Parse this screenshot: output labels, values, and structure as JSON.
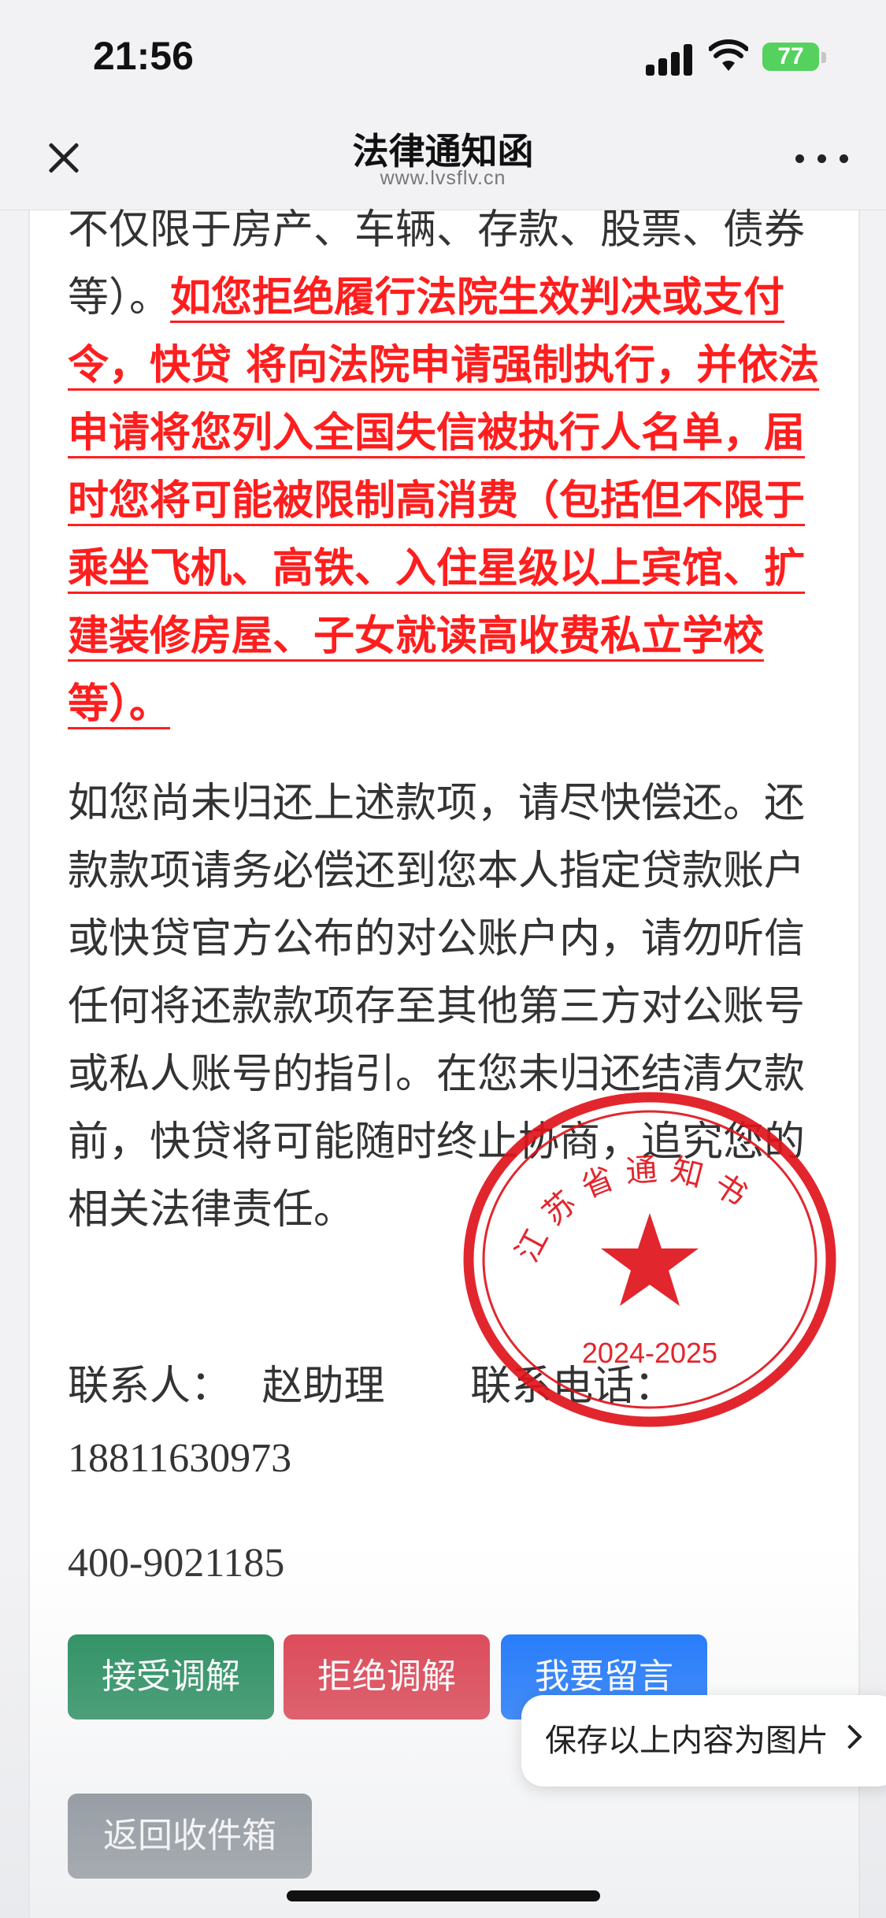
{
  "status_bar": {
    "time": "21:56",
    "battery": "77"
  },
  "nav": {
    "title": "法律通知函",
    "url": "www.lvsflv.cn"
  },
  "letter": {
    "p1_normal": "不仅限于房产、车辆、存款、股票、债券等）。",
    "p1_warning": "如您拒绝履行法院生效判决或支付令，快贷 将向法院申请强制执行，并依法申请将您列入全国失信被执行人名单，届时您将可能被限制高消费（包括但不限于乘坐飞机、高铁、入住星级以上宾馆、扩建装修房屋、子女就读高收费私立学校等）。",
    "p2": "如您尚未归还上述款项，请尽快偿还。还款款项请务必偿还到您本人指定贷款账户或快贷官方公布的对公账户内，请勿听信任何将还款款项存至其他第三方对公账号或私人账号的指引。在您未归还结清欠款前，快贷将可能随时终止协商，追究您的相关法律责任。"
  },
  "contact": {
    "person_label": "联系人：",
    "person_name": "赵助理",
    "phone_label": "联系电话：",
    "phone": "18811630973",
    "hotline": "400-9021185"
  },
  "seal": {
    "text": "江苏省通知书",
    "year": "2024-2025",
    "color": "#e0141c"
  },
  "buttons": {
    "accept": "接受调解",
    "reject": "拒绝调解",
    "message": "我要留言",
    "back": "返回收件箱"
  },
  "save_popup": {
    "label": "保存以上内容为图片"
  },
  "colors": {
    "warning": "#ff1e1e",
    "accept": "#198754",
    "reject": "#dc3545",
    "message": "#0d6efd",
    "back": "#6c757d"
  }
}
